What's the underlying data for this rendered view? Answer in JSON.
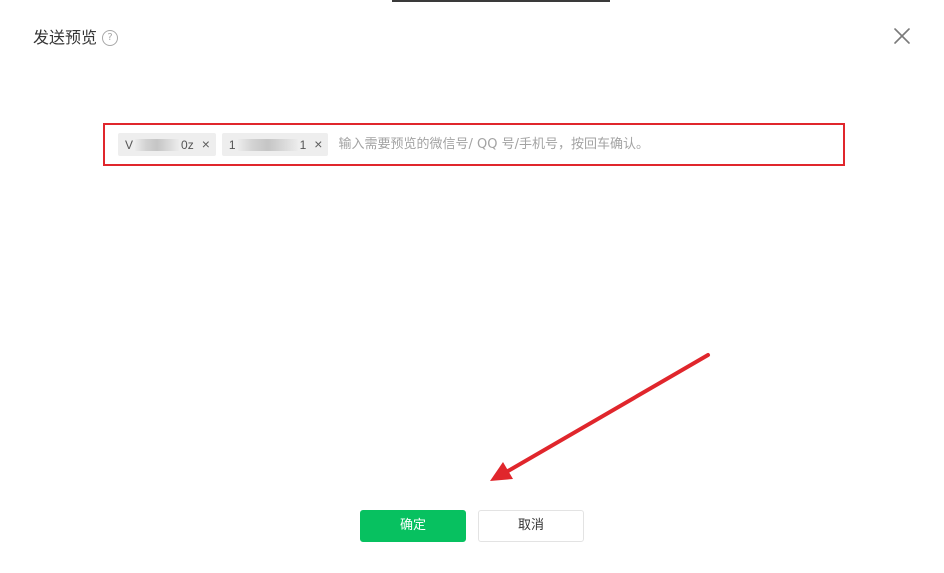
{
  "dialog": {
    "title": "发送预览",
    "help_symbol": "?",
    "recipients": [
      {
        "prefix": "V",
        "suffix": "0z",
        "remove_symbol": "×"
      },
      {
        "prefix": "1",
        "suffix": "1",
        "remove_symbol": "×"
      }
    ],
    "input_placeholder": "输入需要预览的微信号/ QQ 号/手机号，按回车确认。",
    "confirm_label": "确定",
    "cancel_label": "取消"
  },
  "colors": {
    "primary": "#07c160",
    "highlight_border": "#e0262c",
    "annotation_arrow": "#e0262c"
  },
  "icons": {
    "help": "question-circle-icon",
    "close": "close-icon",
    "tag_remove": "x-icon",
    "annotation": "red-arrow-icon"
  }
}
